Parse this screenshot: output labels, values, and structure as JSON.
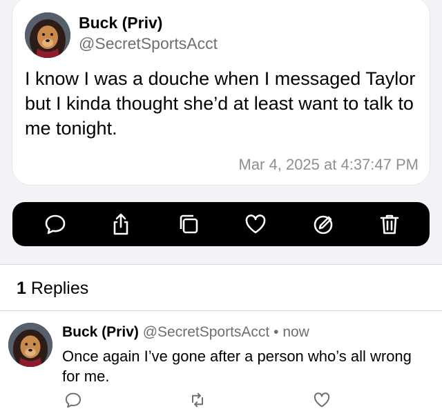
{
  "post": {
    "author_name": "Buck (Priv)",
    "author_handle": "@SecretSportsAcct",
    "text": "I know I was a douche when I messaged Taylor but I kinda thought she’d at least want to talk to me tonight.",
    "timestamp": "Mar 4, 2025 at 4:37:47 PM"
  },
  "toolbar": {
    "icons": [
      "reply-icon",
      "share-icon",
      "copy-icon",
      "like-icon",
      "edit-icon",
      "delete-icon"
    ]
  },
  "replies": {
    "count": "1",
    "label": "Replies",
    "items": [
      {
        "author_name": "Buck (Priv)",
        "author_handle": "@SecretSportsAcct",
        "separator": "•",
        "time": "now",
        "text": "Once again I’ve gone after a person who’s all wrong for me."
      }
    ]
  },
  "colors": {
    "toolbar_bg": "#000000",
    "secondary_text": "#6e6e73",
    "background": "#f2f2f7"
  }
}
